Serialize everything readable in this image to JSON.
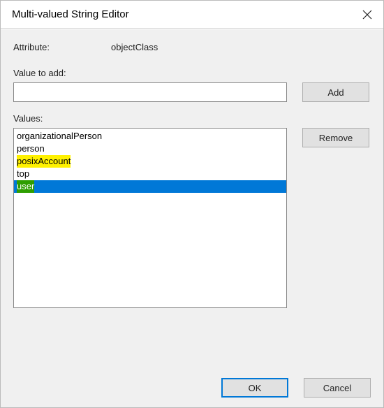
{
  "window": {
    "title": "Multi-valued String Editor",
    "close_icon": "close-icon"
  },
  "attribute": {
    "label": "Attribute:",
    "value": "objectClass"
  },
  "value_to_add": {
    "label": "Value to add:",
    "input_value": "",
    "add_label": "Add"
  },
  "values": {
    "label": "Values:",
    "remove_label": "Remove",
    "items": [
      {
        "text": "organizationalPerson",
        "highlight": "none",
        "selected": false
      },
      {
        "text": "person",
        "highlight": "none",
        "selected": false
      },
      {
        "text": "posixAccount",
        "highlight": "yellow",
        "selected": false
      },
      {
        "text": "top",
        "highlight": "none",
        "selected": false
      },
      {
        "text": "user",
        "highlight": "green",
        "selected": true
      }
    ]
  },
  "footer": {
    "ok_label": "OK",
    "cancel_label": "Cancel"
  }
}
